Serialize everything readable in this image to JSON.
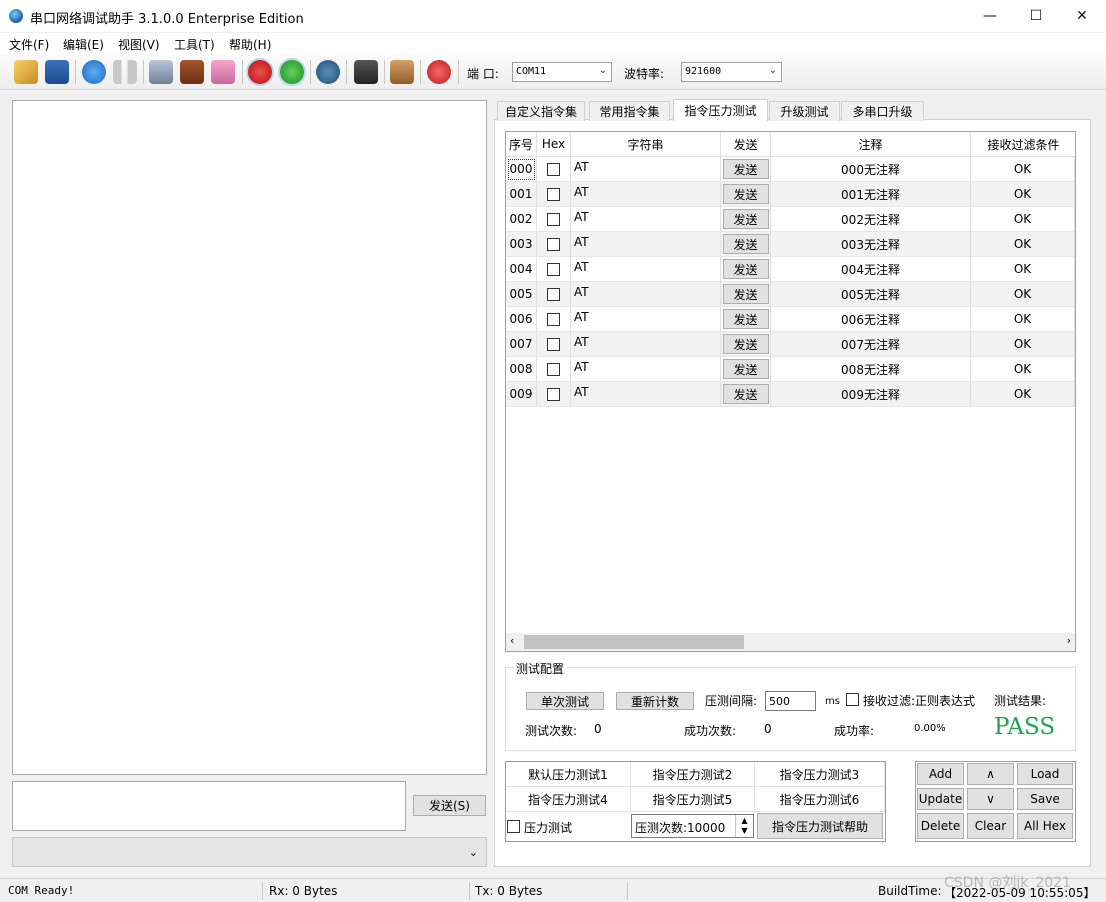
{
  "window": {
    "title": "串口网络调试助手 3.1.0.0 Enterprise Edition",
    "minimize": "—",
    "maximize": "☐",
    "close": "✕"
  },
  "menu": [
    "文件(F)",
    "编辑(E)",
    "视图(V)",
    "工具(T)",
    "帮助(H)"
  ],
  "toolbar": {
    "icons": [
      "open-file-icon",
      "save-icon",
      "play-icon",
      "pause-icon",
      "trash-icon",
      "clear-box-icon",
      "gift-icon",
      "remove-icon",
      "add-icon",
      "settings-icon",
      "bookmark-icon",
      "book-icon",
      "power-icon"
    ],
    "port_label": "端 口:",
    "port_value": "COM11",
    "baud_label": "波特率:",
    "baud_value": "921600"
  },
  "left": {
    "send_button": "发送(S)"
  },
  "tabs": [
    "自定义指令集",
    "常用指令集",
    "指令压力测试",
    "升级测试",
    "多串口升级"
  ],
  "active_tab": 2,
  "grid": {
    "headers": [
      "序号",
      "Hex",
      "字符串",
      "发送",
      "注释",
      "接收过滤条件"
    ],
    "rows": [
      {
        "id": "000",
        "string": "AT",
        "send": "发送",
        "note": "000无注释",
        "filter": "OK"
      },
      {
        "id": "001",
        "string": "AT",
        "send": "发送",
        "note": "001无注释",
        "filter": "OK"
      },
      {
        "id": "002",
        "string": "AT",
        "send": "发送",
        "note": "002无注释",
        "filter": "OK"
      },
      {
        "id": "003",
        "string": "AT",
        "send": "发送",
        "note": "003无注释",
        "filter": "OK"
      },
      {
        "id": "004",
        "string": "AT",
        "send": "发送",
        "note": "004无注释",
        "filter": "OK"
      },
      {
        "id": "005",
        "string": "AT",
        "send": "发送",
        "note": "005无注释",
        "filter": "OK"
      },
      {
        "id": "006",
        "string": "AT",
        "send": "发送",
        "note": "006无注释",
        "filter": "OK"
      },
      {
        "id": "007",
        "string": "AT",
        "send": "发送",
        "note": "007无注释",
        "filter": "OK"
      },
      {
        "id": "008",
        "string": "AT",
        "send": "发送",
        "note": "008无注释",
        "filter": "OK"
      },
      {
        "id": "009",
        "string": "AT",
        "send": "发送",
        "note": "009无注释",
        "filter": "OK"
      }
    ]
  },
  "config": {
    "group_title": "测试配置",
    "single_test": "单次测试",
    "reset_count": "重新计数",
    "interval_label": "压测间隔:",
    "interval_value": "500",
    "interval_unit": "ms",
    "filter_label": "接收过滤:正则表达式",
    "result_label": "测试结果:",
    "result_value": "PASS",
    "test_count_label": "测试次数:",
    "test_count_value": "0",
    "success_count_label": "成功次数:",
    "success_count_value": "0",
    "success_rate_label": "成功率:",
    "success_rate_value": "0.00%"
  },
  "presets": {
    "items": [
      "默认压力测试1",
      "指令压力测试2",
      "指令压力测试3",
      "指令压力测试4",
      "指令压力测试5",
      "指令压力测试6"
    ],
    "stress_checkbox": "压力测试",
    "stress_count": "压测次数:10000",
    "help_button": "指令压力测试帮助"
  },
  "commands": {
    "add": "Add",
    "up": "∧",
    "load": "Load",
    "update": "Update",
    "down": "∨",
    "save": "Save",
    "delete": "Delete",
    "clear": "Clear",
    "all_hex": "All Hex"
  },
  "status": {
    "state": "COM Ready!",
    "rx": "Rx: 0 Bytes",
    "tx": "Tx: 0 Bytes",
    "build_time_label": "BuildTime:",
    "build_time_value": "【2022-05-09 10:55:05】"
  },
  "watermark": "CSDN @刘jk_2021"
}
